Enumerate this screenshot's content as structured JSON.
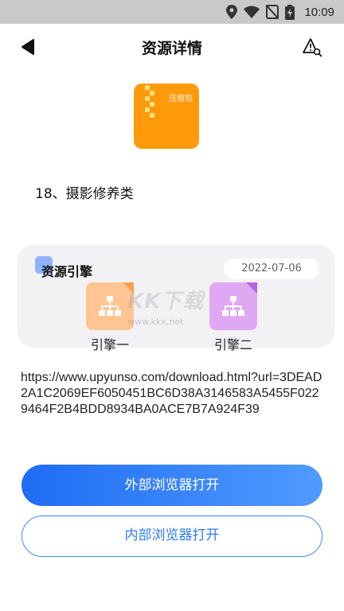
{
  "status_bar": {
    "time": "10:09",
    "icons": [
      "location-icon",
      "wifi-icon",
      "no-sim-icon",
      "battery-charging-icon"
    ]
  },
  "header": {
    "title": "资源详情",
    "back_icon": "back-arrow-icon",
    "report_icon": "warning-search-icon"
  },
  "resource": {
    "icon_label": "压缩包",
    "icon_color": "#ff9a0a",
    "name": "18、摄影修养类"
  },
  "engine_section": {
    "title": "资源引擎",
    "date": "2022-07-06",
    "engines": [
      {
        "label": "引擎一",
        "color": "#ffc592",
        "selected": true
      },
      {
        "label": "引擎二",
        "color": "#dfa8f3",
        "selected": true
      }
    ]
  },
  "watermark": {
    "main": "KK下载",
    "sub": "www.kkx.net"
  },
  "link": {
    "url": "https://www.upyunso.com/download.html?url=3DEAD2A1C2069EF6050451BC6D38A3146583A5455F0229464F2B4BDD8934BA0ACE7B7A924F39"
  },
  "actions": {
    "external_label": "外部浏览器打开",
    "internal_label": "内部浏览器打开",
    "accent": "#2f7bf0"
  }
}
